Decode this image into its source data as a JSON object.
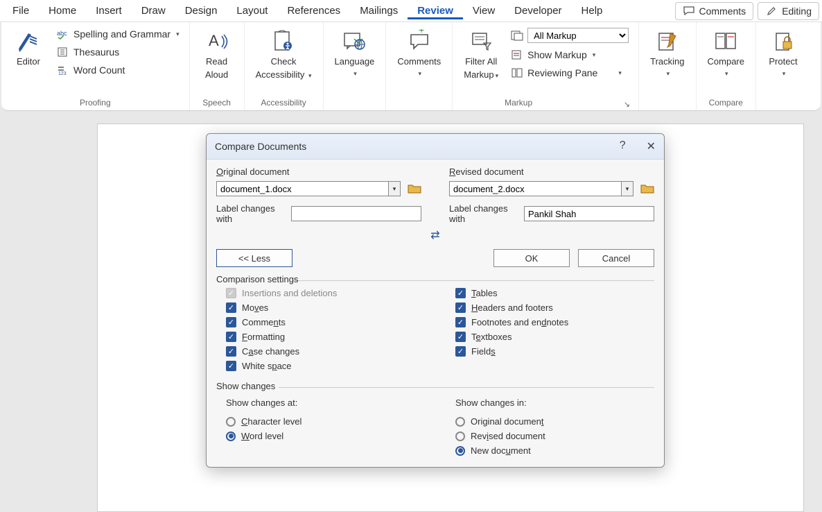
{
  "menu": {
    "tabs": [
      "File",
      "Home",
      "Insert",
      "Draw",
      "Design",
      "Layout",
      "References",
      "Mailings",
      "Review",
      "View",
      "Developer",
      "Help"
    ],
    "active": "Review",
    "comments_btn": "Comments",
    "editing_btn": "Editing"
  },
  "ribbon": {
    "proofing": {
      "label": "Proofing",
      "editor": "Editor",
      "spelling": "Spelling and Grammar",
      "thesaurus": "Thesaurus",
      "wordcount": "Word Count"
    },
    "speech": {
      "label": "Speech",
      "read": "Read",
      "aloud": "Aloud"
    },
    "accessibility": {
      "label": "Accessibility",
      "check": "Check",
      "access": "Accessibility"
    },
    "language": {
      "label": "Language"
    },
    "comments": {
      "label": "Comments"
    },
    "filter": {
      "l1": "Filter All",
      "l2": "Markup"
    },
    "markup": {
      "label": "Markup",
      "select": "All Markup",
      "show": "Show Markup",
      "pane": "Reviewing Pane"
    },
    "tracking": {
      "label": "Tracking"
    },
    "compare": {
      "label": "Compare",
      "group": "Compare"
    },
    "protect": {
      "label": "Protect"
    }
  },
  "dialog": {
    "title": "Compare Documents",
    "orig_label": "Original document",
    "orig_value": "document_1.docx",
    "rev_label": "Revised document",
    "rev_value": "document_2.docx",
    "label_changes": "Label changes with",
    "orig_author": "",
    "rev_author": "Pankil Shah",
    "less": "<< Less",
    "ok": "OK",
    "cancel": "Cancel",
    "comp_settings": "Comparison settings",
    "chk": {
      "insdel": "Insertions and deletions",
      "moves": "Moves",
      "comments": "Comments",
      "formatting": "Formatting",
      "case": "Case changes",
      "whitespace": "White space",
      "tables": "Tables",
      "headers": "Headers and footers",
      "footnotes": "Footnotes and endnotes",
      "textboxes": "Textboxes",
      "fields": "Fields"
    },
    "show_changes": "Show changes",
    "show_at": "Show changes at:",
    "char_level": "Character level",
    "word_level": "Word level",
    "show_in": "Show changes in:",
    "orig_doc": "Original document",
    "rev_doc": "Revised document",
    "new_doc": "New document"
  }
}
